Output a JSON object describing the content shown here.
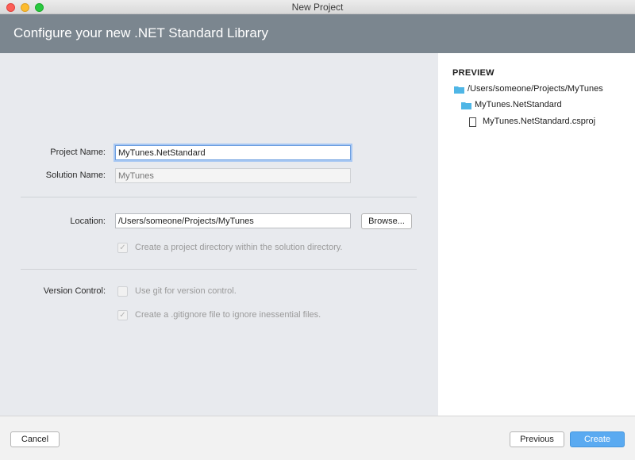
{
  "window": {
    "title": "New Project"
  },
  "header": {
    "title": "Configure your new .NET Standard Library"
  },
  "form": {
    "project_name": {
      "label": "Project Name:",
      "value": "MyTunes.NetStandard"
    },
    "solution_name": {
      "label": "Solution Name:",
      "placeholder": "MyTunes"
    },
    "location": {
      "label": "Location:",
      "value": "/Users/someone/Projects/MyTunes",
      "browse_label": "Browse..."
    },
    "create_project_dir": {
      "label": "Create a project directory within the solution directory.",
      "checked": true
    },
    "version_control": {
      "label": "Version Control:",
      "use_git": {
        "label": "Use git for version control.",
        "checked": false
      },
      "gitignore": {
        "label": "Create a .gitignore file to ignore inessential files.",
        "checked": true
      }
    }
  },
  "preview": {
    "title": "PREVIEW",
    "tree": [
      {
        "type": "folder",
        "label": "/Users/someone/Projects/MyTunes"
      },
      {
        "type": "folder",
        "label": "MyTunes.NetStandard"
      },
      {
        "type": "file",
        "label": "MyTunes.NetStandard.csproj"
      }
    ]
  },
  "footer": {
    "cancel_label": "Cancel",
    "previous_label": "Previous",
    "create_label": "Create"
  },
  "colors": {
    "header_bg": "#7b868f",
    "accent": "#5aaaf1",
    "folder_icon": "#4fb6e6"
  }
}
